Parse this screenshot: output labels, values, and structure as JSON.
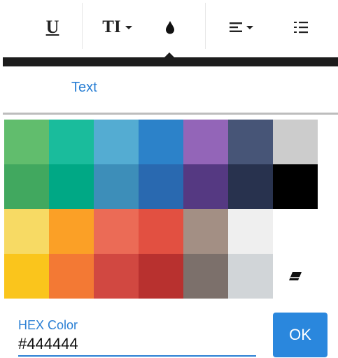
{
  "toolbar": {
    "underline_label": "U",
    "font_size_label": "TI",
    "align_glyph": "≡",
    "colors": {
      "icon": "#222222"
    }
  },
  "popup": {
    "tab_label": "Text",
    "accent": "#2a7fd4"
  },
  "palette": [
    "#61bd6d",
    "#1abc9c",
    "#54acd2",
    "#2c82c9",
    "#9365b8",
    "#475577",
    "#cccccc",
    "#41a85f",
    "#00a885",
    "#3d8eb9",
    "#2969b0",
    "#553982",
    "#28324e",
    "#000000",
    "#f7da64",
    "#fba026",
    "#eb6b56",
    "#e25041",
    "#a38f84",
    "#efefef",
    "#ffffff",
    "#fac51c",
    "#f37934",
    "#d14841",
    "#b8312f",
    "#7c706b",
    "#d1d5d8",
    "eraser"
  ],
  "hex": {
    "label": "HEX Color",
    "value": "#444444"
  },
  "ok_button": {
    "label": "OK",
    "color": "#2a87dd"
  }
}
